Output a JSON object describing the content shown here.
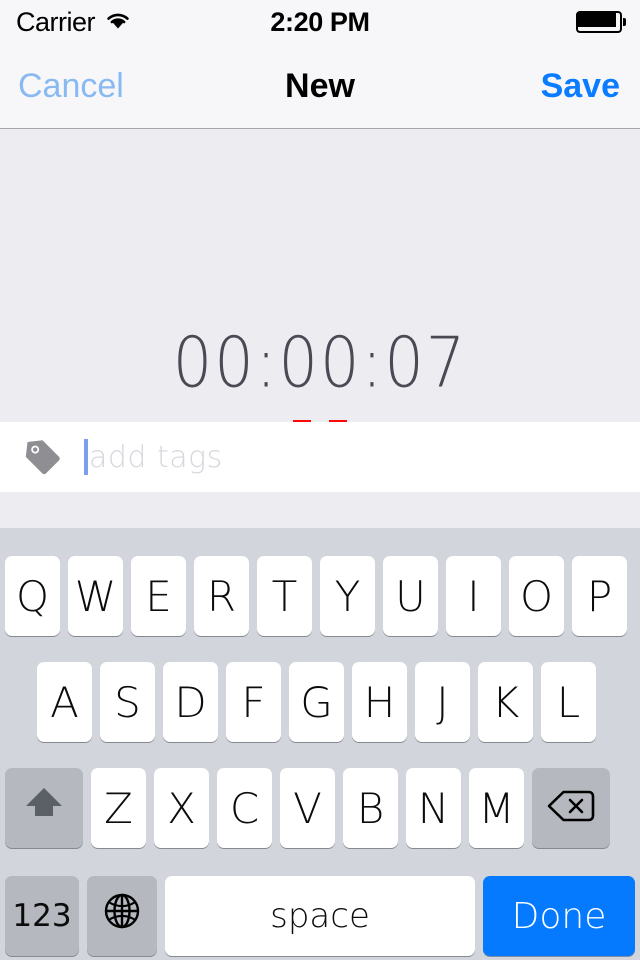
{
  "status_bar": {
    "carrier": "Carrier",
    "wifi_icon": "wifi-icon",
    "time": "2:20 PM",
    "battery_icon": "battery-full-icon"
  },
  "nav_bar": {
    "cancel_label": "Cancel",
    "title": "New",
    "save_label": "Save",
    "cancel_color": "#63a6ef",
    "save_color": "#0a7cff"
  },
  "timer": {
    "display": "00:00:07",
    "hours": "00",
    "minutes": "00",
    "seconds": "07",
    "state": "running",
    "control_icon": "pause-icon",
    "control_color": "#fb0a06",
    "panel_color": "#edecf1"
  },
  "tag_field": {
    "icon": "tag-icon",
    "value": "",
    "placeholder": "add tags",
    "caret_color": "#7d9df0",
    "focused": true
  },
  "keyboard": {
    "layout": "qwerty-uppercase",
    "background": "#d2d5db",
    "rows": [
      [
        "Q",
        "W",
        "E",
        "R",
        "T",
        "Y",
        "U",
        "I",
        "O",
        "P"
      ],
      [
        "A",
        "S",
        "D",
        "F",
        "G",
        "H",
        "J",
        "K",
        "L"
      ],
      [
        "Z",
        "X",
        "C",
        "V",
        "B",
        "N",
        "M"
      ]
    ],
    "shift_icon": "shift-up-arrow-icon",
    "backspace_icon": "backspace-delete-icon",
    "numbers_label": "123",
    "globe_icon": "globe-language-icon",
    "space_label": "space",
    "done_label": "Done",
    "done_color": "#067aff"
  }
}
